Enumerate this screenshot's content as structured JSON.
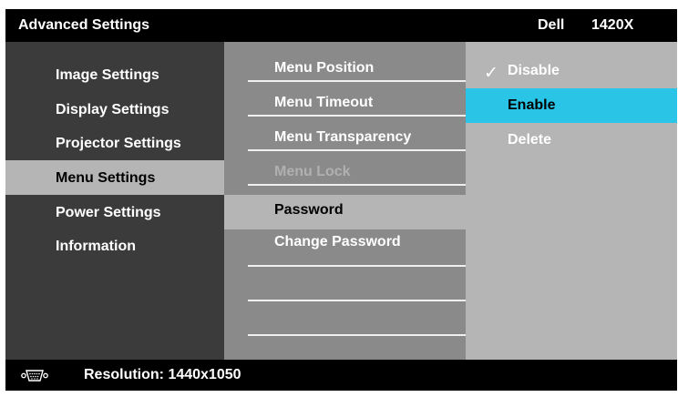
{
  "header": {
    "title": "Advanced Settings",
    "brand": "Dell",
    "model": "1420X"
  },
  "menu": {
    "items": [
      {
        "label": "Image Settings"
      },
      {
        "label": "Display Settings"
      },
      {
        "label": "Projector Settings"
      },
      {
        "label": "Menu Settings"
      },
      {
        "label": "Power Settings"
      },
      {
        "label": "Information"
      }
    ],
    "selected": "Menu Settings"
  },
  "submenu": {
    "items": [
      {
        "label": "Menu Position"
      },
      {
        "label": "Menu Timeout"
      },
      {
        "label": "Menu Transparency"
      },
      {
        "label": "Menu Lock",
        "disabled": true
      },
      {
        "label": "Password"
      },
      {
        "label": "Change Password"
      }
    ],
    "selected": "Password"
  },
  "options": {
    "items": [
      {
        "label": "Disable",
        "checked": true
      },
      {
        "label": "Enable"
      },
      {
        "label": "Delete"
      }
    ],
    "highlighted": "Enable",
    "check_symbol": "✓"
  },
  "footer": {
    "resolution_text": "Resolution: 1440x1050",
    "icon": "vga-input-icon"
  },
  "colors": {
    "highlight": "#29c4e6",
    "selected_bg": "#b5b5b5",
    "left_panel": "#3b3b3b",
    "middle_panel": "#8a8a8a",
    "right_panel": "#b5b5b5"
  }
}
